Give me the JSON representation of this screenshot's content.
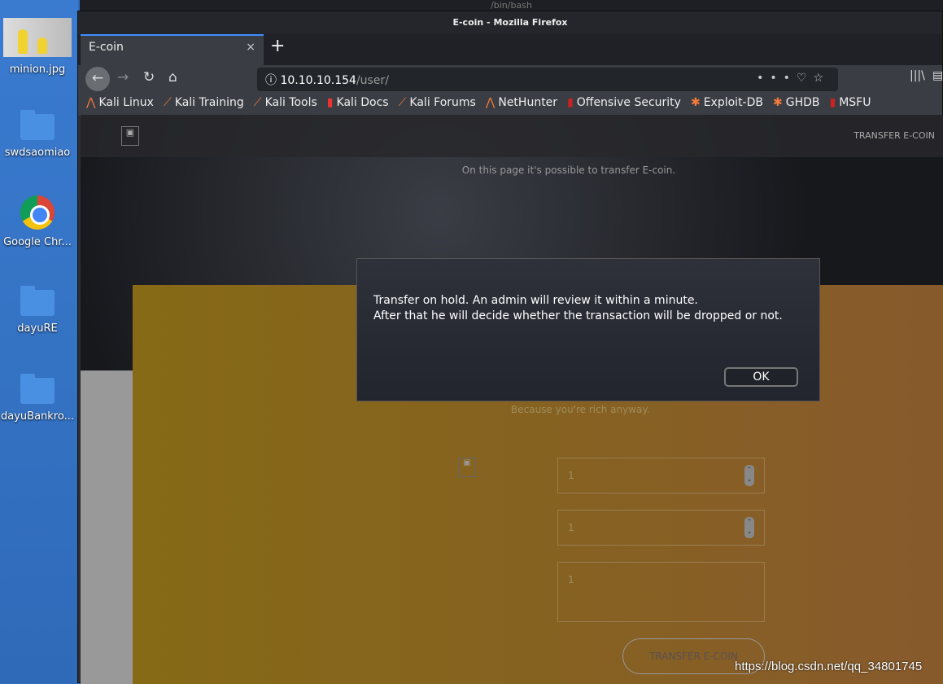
{
  "desktop": {
    "icons": [
      {
        "label": "minion.jpg"
      },
      {
        "label": "swdsaomiao"
      },
      {
        "label": "Google Chr..."
      },
      {
        "label": "dayuRE"
      },
      {
        "label": "dayuBankro..."
      }
    ]
  },
  "terminal": {
    "title": "/bin/bash"
  },
  "browser": {
    "window_title": "E-coin - Mozilla Firefox",
    "tab_title": "E-coin",
    "tab_close": "×",
    "new_tab": "+",
    "url_host": "10.10.10.154",
    "url_path": "/user/",
    "bookmarks": [
      "Kali Linux",
      "Kali Training",
      "Kali Tools",
      "Kali Docs",
      "Kali Forums",
      "NetHunter",
      "Offensive Security",
      "Exploit-DB",
      "GHDB",
      "MSFU"
    ]
  },
  "page": {
    "nav_link": "TRANSFER E-COIN",
    "hero_text": "On this page it's possible to transfer E-coin.",
    "subtitle": "Because you're rich anyway.",
    "fields": [
      "1",
      "1",
      "1"
    ],
    "submit": "TRANSFER E-COIN"
  },
  "dialog": {
    "line1": "Transfer on hold. An admin will review it within a minute.",
    "line2": "After that he will decide whether the transaction will be dropped or not.",
    "ok": "OK"
  },
  "watermark": "https://blog.csdn.net/qq_34801745"
}
